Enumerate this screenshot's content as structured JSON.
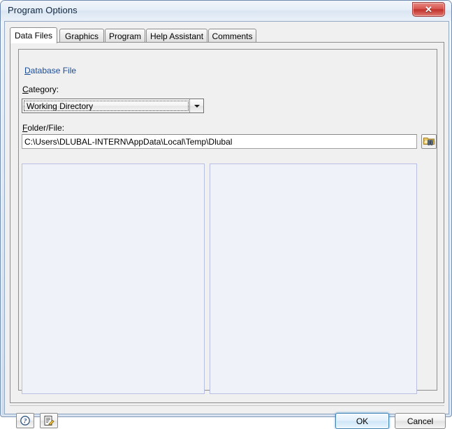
{
  "window": {
    "title": "Program Options",
    "close_glyph": "✕",
    "close_label": "Close"
  },
  "tabs": [
    {
      "label": "Data Files",
      "active": true
    },
    {
      "label": "Graphics",
      "active": false
    },
    {
      "label": "Program",
      "active": false
    },
    {
      "label": "Help Assistant",
      "active": false
    },
    {
      "label": "Comments",
      "active": false
    }
  ],
  "group": {
    "title_accel": "D",
    "title_rest": "atabase File"
  },
  "fields": {
    "category": {
      "label_accel": "C",
      "label_rest": "ategory:",
      "value": "Working Directory",
      "options": [
        "Working Directory"
      ]
    },
    "folder": {
      "label_accel": "F",
      "label_rest": "older/File:",
      "value": "C:\\Users\\DLUBAL-INTERN\\AppData\\Local\\Temp\\Dlubal",
      "placeholder": "",
      "browse_label": "Browse"
    }
  },
  "panels": {
    "left": {
      "items": []
    },
    "right": {
      "items": []
    }
  },
  "footer": {
    "help_label": "Help",
    "comment_label": "Comment",
    "ok_label": "OK",
    "cancel_label": "Cancel"
  },
  "colors": {
    "group_title": "#1b4c96",
    "close_red": "#c0322b",
    "default_button_border": "#3c7fb1",
    "panel_bg": "#eff2f8",
    "panel_border": "#b9bfe0"
  }
}
